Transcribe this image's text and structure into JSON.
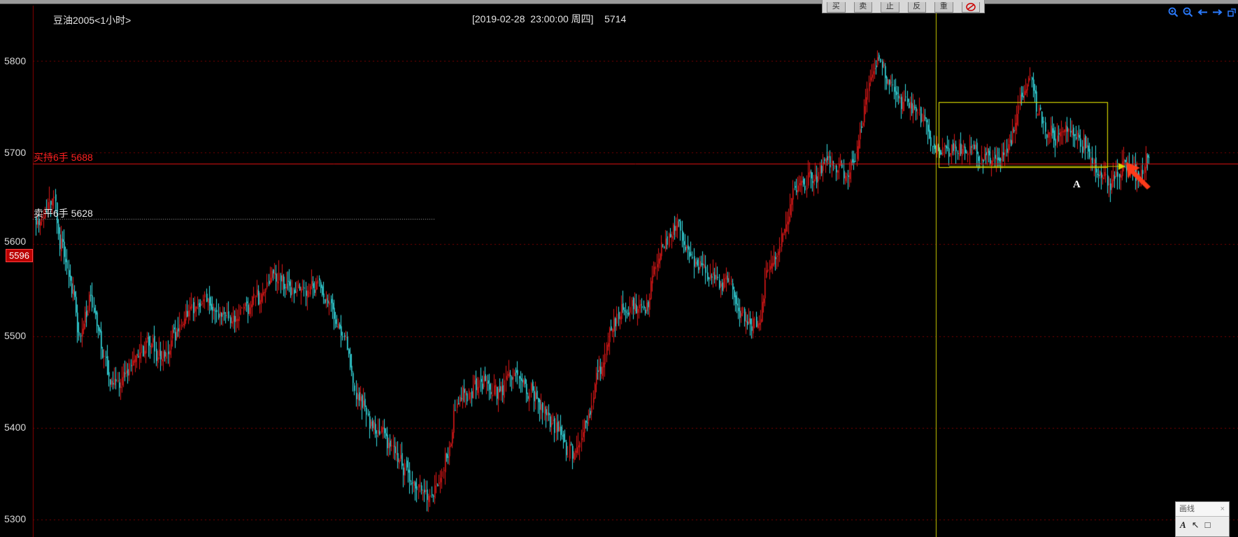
{
  "window": {
    "instrument_title": "豆油2005<1小时>",
    "cursor_info": "[2019-02-28  23:00:00 周四]    5714"
  },
  "toolbar": {
    "buttons": [
      "买",
      "卖",
      "止",
      "反",
      "重"
    ],
    "clear_icon": "pen-erase-icon"
  },
  "nav": {
    "icons": [
      "zoom-in-icon",
      "zoom-out-icon",
      "scroll-left-icon",
      "scroll-right-icon",
      "restore-icon"
    ]
  },
  "orders": {
    "buy_hold": {
      "label": "买持6手 5688",
      "price": 5688,
      "color": "#ff2020"
    },
    "sell_close": {
      "label": "卖平6手 5628",
      "price": 5628,
      "color": "#e0e0e0"
    }
  },
  "current_price_tag": "5596",
  "annotation_label": "A",
  "draw_panel": {
    "title": "画线",
    "close": "×",
    "tools": [
      "A",
      "↖",
      "□"
    ]
  },
  "colors": {
    "up": "#e01818",
    "down": "#37e3e8",
    "grid": "#7a0000",
    "axis": "#8a0000",
    "cursor_line": "#c8c800",
    "box": "#d4d400",
    "arrow": "#ff3b1a"
  },
  "chart_data": {
    "type": "candlestick",
    "instrument": "豆油2005",
    "timeframe": "1小时",
    "y_ticks": [
      5800,
      5700,
      5600,
      5500,
      5400,
      5300
    ],
    "ylim": [
      5285,
      5860
    ],
    "grid": true,
    "trend_path": [
      [
        0,
        5630
      ],
      [
        12,
        5640
      ],
      [
        16,
        5600
      ],
      [
        24,
        5560
      ],
      [
        28,
        5500
      ],
      [
        36,
        5540
      ],
      [
        48,
        5450
      ],
      [
        60,
        5460
      ],
      [
        72,
        5490
      ],
      [
        84,
        5480
      ],
      [
        100,
        5520
      ],
      [
        110,
        5540
      ],
      [
        124,
        5520
      ],
      [
        140,
        5530
      ],
      [
        160,
        5560
      ],
      [
        172,
        5550
      ],
      [
        190,
        5560
      ],
      [
        200,
        5530
      ],
      [
        210,
        5480
      ],
      [
        218,
        5430
      ],
      [
        226,
        5400
      ],
      [
        240,
        5380
      ],
      [
        256,
        5340
      ],
      [
        266,
        5320
      ],
      [
        276,
        5370
      ],
      [
        284,
        5430
      ],
      [
        300,
        5450
      ],
      [
        312,
        5440
      ],
      [
        324,
        5460
      ],
      [
        336,
        5430
      ],
      [
        350,
        5400
      ],
      [
        364,
        5370
      ],
      [
        376,
        5440
      ],
      [
        386,
        5500
      ],
      [
        398,
        5540
      ],
      [
        410,
        5520
      ],
      [
        422,
        5600
      ],
      [
        434,
        5620
      ],
      [
        444,
        5580
      ],
      [
        456,
        5560
      ],
      [
        468,
        5550
      ],
      [
        478,
        5520
      ],
      [
        486,
        5510
      ],
      [
        494,
        5570
      ],
      [
        502,
        5600
      ],
      [
        510,
        5660
      ],
      [
        522,
        5670
      ],
      [
        534,
        5690
      ],
      [
        546,
        5680
      ],
      [
        554,
        5700
      ],
      [
        560,
        5780
      ],
      [
        570,
        5800
      ],
      [
        580,
        5760
      ],
      [
        596,
        5740
      ],
      [
        608,
        5700
      ],
      [
        620,
        5710
      ],
      [
        640,
        5690
      ],
      [
        656,
        5710
      ],
      [
        668,
        5780
      ],
      [
        682,
        5720
      ],
      [
        700,
        5720
      ],
      [
        714,
        5690
      ],
      [
        724,
        5660
      ],
      [
        734,
        5690
      ],
      [
        744,
        5670
      ],
      [
        752,
        5700
      ]
    ],
    "candle_count": 752,
    "seed": 11
  }
}
